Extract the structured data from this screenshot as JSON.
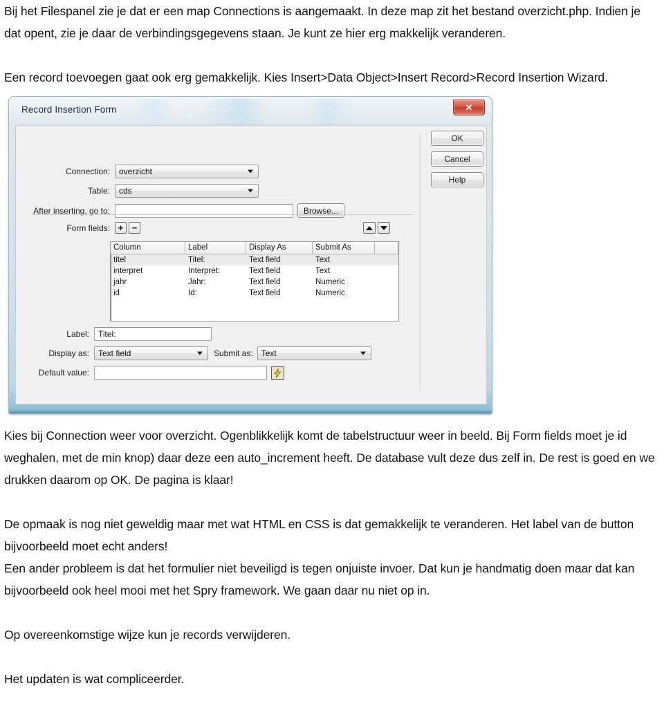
{
  "document": {
    "paragraphs_top": [
      "Bij het Filespanel zie je dat er een map Connections is aangemaakt. In deze map zit het bestand overzicht.php. Indien je dat opent, zie je daar de verbindingsgegevens staan. Je kunt ze hier erg makkelijk veranderen.",
      "Een record toevoegen gaat ook erg gemakkelijk.  Kies Insert>Data Object>Insert Record>Record Insertion Wizard."
    ],
    "paragraphs_bottom": [
      "Kies bij Connection weer voor overzicht. Ogenblikkelijk komt de tabelstructuur weer in beeld. Bij Form fields moet je id weghalen, met de min knop) daar deze een auto_increment heeft. De database vult deze dus zelf in. De rest is goed en we drukken daarom op OK. De pagina is klaar!",
      "De opmaak is nog niet geweldig maar met wat HTML en CSS is dat gemakkelijk te veranderen. Het label van de button bijvoorbeeld moet echt anders!",
      "Een ander probleem is dat het formulier niet beveiligd is tegen onjuiste invoer. Dat kun je handmatig doen maar dat kan bijvoorbeeld ook heel mooi met het Spry framework. We gaan daar nu niet op in.",
      "Op overeenkomstige wijze kun je records verwijderen.",
      "Het updaten is wat compliceerder."
    ]
  },
  "dialog": {
    "title": "Record Insertion Form",
    "close_label": "✕",
    "buttons": {
      "ok": "OK",
      "cancel": "Cancel",
      "help": "Help"
    },
    "fields": {
      "connection_label": "Connection:",
      "connection_value": "overzicht",
      "table_label": "Table:",
      "table_value": "cds",
      "after_inserting_label": "After inserting, go to:",
      "after_inserting_value": "",
      "browse_label": "Browse...",
      "form_fields_label": "Form fields:",
      "plus_label": "+",
      "minus_label": "−",
      "label_label": "Label:",
      "label_value": "Titel:",
      "display_as_label": "Display as:",
      "display_as_value": "Text field",
      "submit_as_label": "Submit as:",
      "submit_as_value": "Text",
      "default_value_label": "Default value:",
      "default_value_value": ""
    },
    "grid": {
      "headers": [
        "Column",
        "Label",
        "Display As",
        "Submit As",
        ""
      ],
      "rows": [
        {
          "column": "titel",
          "label": "Titel:",
          "display_as": "Text field",
          "submit_as": "Text",
          "extra": ""
        },
        {
          "column": "interpret",
          "label": "Interpret:",
          "display_as": "Text field",
          "submit_as": "Text",
          "extra": ""
        },
        {
          "column": "jahr",
          "label": "Jahr:",
          "display_as": "Text field",
          "submit_as": "Numeric",
          "extra": ""
        },
        {
          "column": "id",
          "label": "Id:",
          "display_as": "Text field",
          "submit_as": "Numeric",
          "extra": ""
        }
      ]
    },
    "colors": {
      "close_red": "#c33f2d",
      "title_text": "#17304a",
      "body_bg": "#f0f0f0",
      "lightning_yellow": "#f5d936"
    }
  }
}
